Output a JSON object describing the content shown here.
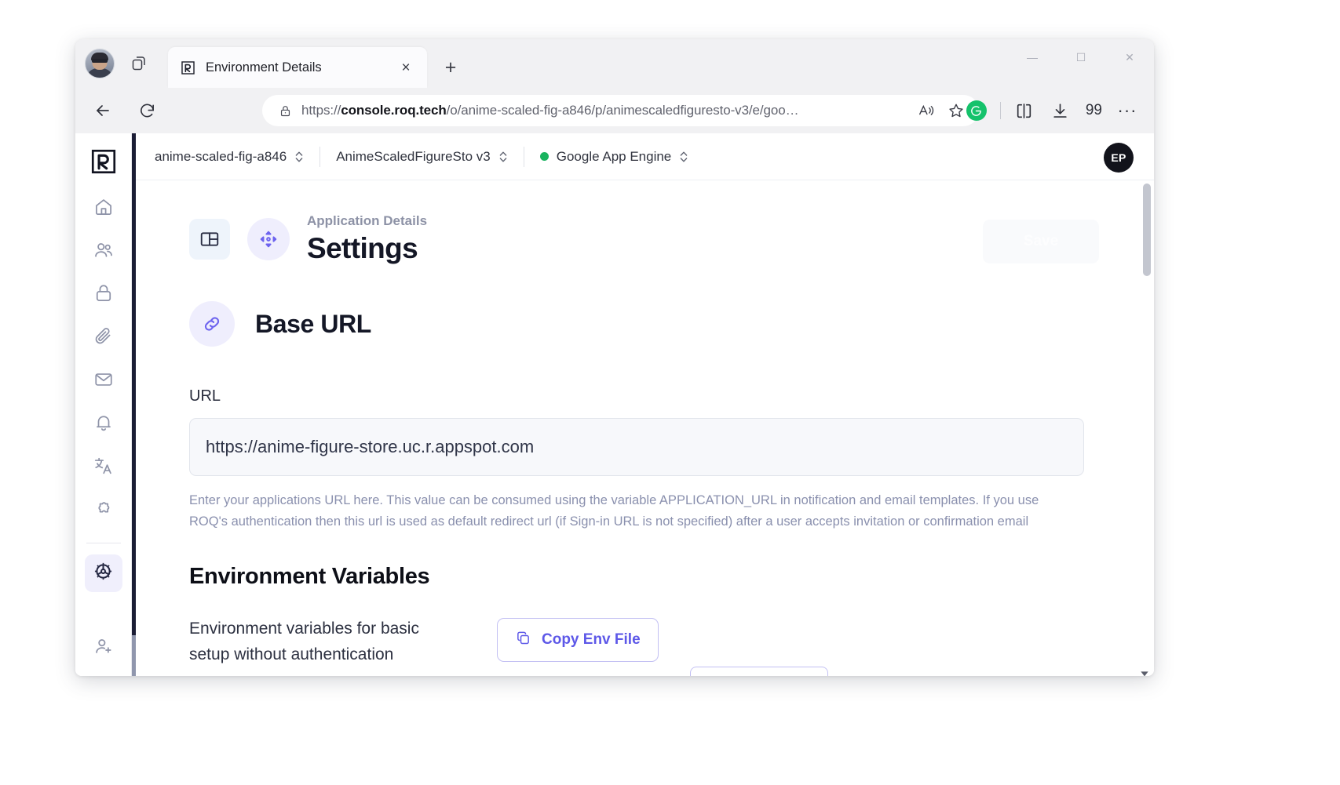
{
  "browser": {
    "tab": {
      "title": "Environment Details",
      "favicon": "roq-logo-icon"
    },
    "new_tab_label": "+",
    "close_label": "×",
    "url_prefix": "https://",
    "url_domain": "console.roq.tech",
    "url_path": "/o/anime-scaled-fig-a846/p/animescaledfiguresto-v3/e/goo…",
    "download_count": "99",
    "menu_label": "···",
    "window_controls": {
      "minimize": "—",
      "maximize": "☐",
      "close": "✕"
    }
  },
  "app": {
    "logo": "roq-logo-icon",
    "breadcrumbs": [
      {
        "label": "anime-scaled-fig-a846",
        "has_status_dot": false
      },
      {
        "label": "AnimeScaledFigureSto v3",
        "has_status_dot": false
      },
      {
        "label": "Google App Engine",
        "has_status_dot": true,
        "status_color": "#19b35f"
      }
    ],
    "user_initials": "EP",
    "sidebar": [
      {
        "name": "home",
        "icon": "home-icon"
      },
      {
        "name": "users",
        "icon": "users-icon"
      },
      {
        "name": "security",
        "icon": "lock-icon"
      },
      {
        "name": "files",
        "icon": "paperclip-icon"
      },
      {
        "name": "mail",
        "icon": "envelope-icon"
      },
      {
        "name": "notifications",
        "icon": "bell-icon"
      },
      {
        "name": "translations",
        "icon": "translate-icon"
      },
      {
        "name": "plugins",
        "icon": "puzzle-icon"
      },
      {
        "name": "settings",
        "icon": "gear-icon",
        "active": true
      },
      {
        "name": "invite-user",
        "icon": "user-plus-icon"
      }
    ]
  },
  "page": {
    "eyebrow": "Application Details",
    "title": "Settings",
    "save_label": "Save",
    "save_disabled": true,
    "section": {
      "icon": "link-icon",
      "heading": "Base URL",
      "field_label": "URL",
      "url_value": "https://anime-figure-store.uc.r.appspot.com",
      "helper": "Enter your applications URL here. This value can be consumed using the variable APPLICATION_URL in notification and email templates. If you use ROQ's authentication then this url is used as default redirect url (if Sign-in URL is not specified) after a user accepts invitation or confirmation email"
    },
    "env": {
      "heading": "Environment Variables",
      "description": "Environment variables for basic setup without authentication",
      "copy_button": "Copy Env File"
    }
  },
  "colors": {
    "accent": "#5d58e8",
    "accent_soft": "#efeefd",
    "status_green": "#19b35f",
    "rail_dark": "#1b1d35",
    "text_dark": "#141726",
    "text_muted": "#8a90ae"
  }
}
